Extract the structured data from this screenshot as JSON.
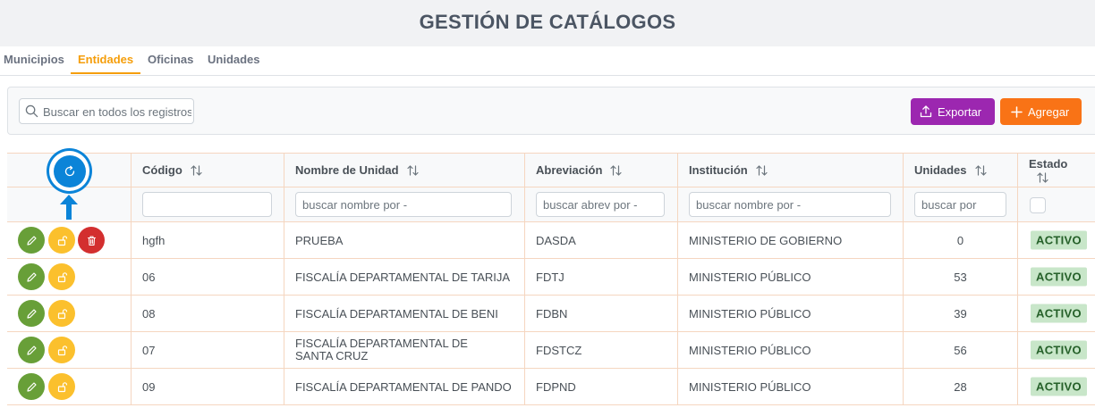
{
  "page": {
    "title": "GESTIÓN DE CATÁLOGOS"
  },
  "tabs": [
    {
      "label": "Municipios"
    },
    {
      "label": "Entidades"
    },
    {
      "label": "Oficinas"
    },
    {
      "label": "Unidades"
    }
  ],
  "active_tab": "Entidades",
  "toolbar": {
    "search_placeholder": "Buscar en todos los registros",
    "export_label": "Exportar",
    "add_label": "Agregar"
  },
  "table": {
    "columns": {
      "codigo": "Código",
      "nombre": "Nombre de Unidad",
      "abreviacion": "Abreviación",
      "institucion": "Institución",
      "unidades": "Unidades",
      "estado": "Estado"
    },
    "filters": {
      "codigo": "",
      "nombre": "buscar nombre por -",
      "abreviacion": "buscar abrev por -",
      "institucion": "buscar nombre por -",
      "unidades": "buscar por"
    },
    "rows": [
      {
        "codigo": "hgfh",
        "nombre": "PRUEBA",
        "abreviacion": "DASDA",
        "institucion": "MINISTERIO DE GOBIERNO",
        "unidades": "0",
        "estado": "ACTIVO"
      },
      {
        "codigo": "06",
        "nombre": "FISCALÍA DEPARTAMENTAL DE TARIJA",
        "abreviacion": "FDTJ",
        "institucion": "MINISTERIO PÚBLICO",
        "unidades": "53",
        "estado": "ACTIVO"
      },
      {
        "codigo": "08",
        "nombre": "FISCALÍA DEPARTAMENTAL DE BENI",
        "abreviacion": "FDBN",
        "institucion": "MINISTERIO PÚBLICO",
        "unidades": "39",
        "estado": "ACTIVO"
      },
      {
        "codigo": "07",
        "nombre": "FISCALÍA DEPARTAMENTAL DE SANTA CRUZ",
        "abreviacion": "FDSTCZ",
        "institucion": "MINISTERIO PÚBLICO",
        "unidades": "56",
        "estado": "ACTIVO"
      },
      {
        "codigo": "09",
        "nombre": "FISCALÍA DEPARTAMENTAL DE PANDO",
        "abreviacion": "FDPND",
        "institucion": "MINISTERIO PÚBLICO",
        "unidades": "28",
        "estado": "ACTIVO"
      }
    ]
  },
  "colors": {
    "accent_orange": "#f59e0b",
    "export_purple": "#9c27b0",
    "add_orange": "#f97316",
    "edit_green": "#689f38",
    "lock_yellow": "#fbc02d",
    "delete_red": "#d32f2f",
    "refresh_blue": "#0b84d8",
    "active_badge": "#c8e6c9"
  }
}
